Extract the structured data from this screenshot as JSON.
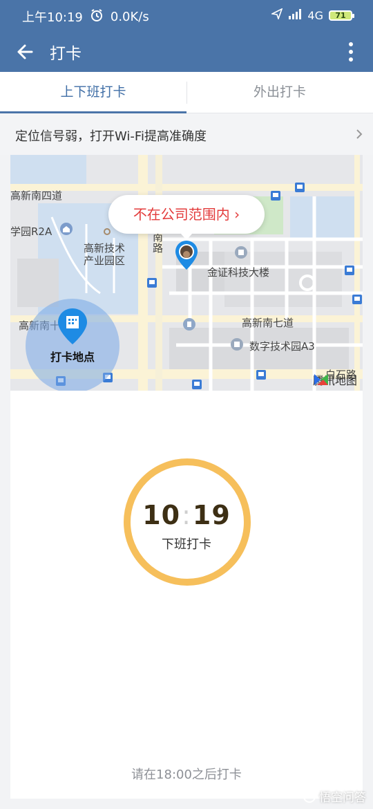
{
  "status_bar": {
    "time": "上午10:19",
    "network_speed": "0.0K/s",
    "network_type": "4G",
    "battery": "71"
  },
  "app_bar": {
    "title": "打卡"
  },
  "tabs": [
    {
      "label": "上下班打卡",
      "active": true
    },
    {
      "label": "外出打卡",
      "active": false
    }
  ],
  "notice": {
    "text": "定位信号弱，打开Wi-Fi提高准确度"
  },
  "map": {
    "callout": "不在公司范围内 ›",
    "punch_point_label": "打卡地点",
    "labels": [
      "高新南四道",
      "学园R2A",
      "高新技术",
      "产业园区",
      "南",
      "路",
      "金证科技大楼",
      "高新南十",
      "高新南七道",
      "数字技术园A3",
      "白石路"
    ],
    "logo_text": "腾讯地图"
  },
  "clock": {
    "hours": "10",
    "separator": ":",
    "minutes": "19",
    "caption": "下班打卡"
  },
  "hint": "请在18:00之后打卡",
  "watermark": "悟空问答",
  "colors": {
    "primary": "#4a74a8",
    "ring": "#f6bf5b",
    "alert": "#e33b3b"
  }
}
